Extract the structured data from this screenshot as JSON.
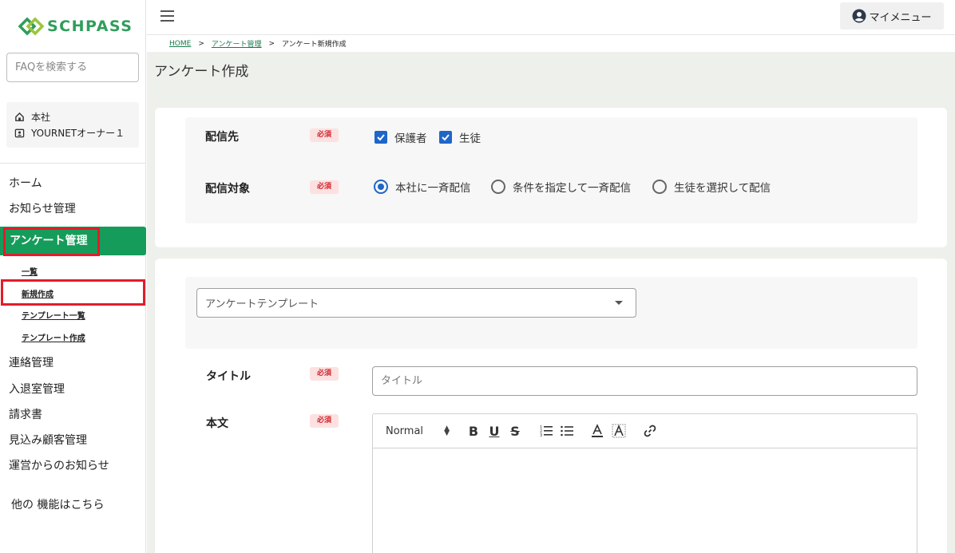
{
  "brand": {
    "name": "SCHPASS",
    "color": "#2f9e5b"
  },
  "sidebar": {
    "faq_placeholder": "FAQを検索する",
    "org": {
      "branch": "本社",
      "user": "YOURNETオーナー１"
    },
    "nav": {
      "home": "ホーム",
      "notice": "お知らせ管理",
      "survey": "アンケート管理",
      "survey_sub": [
        "一覧",
        "新規作成",
        "テンプレート一覧",
        "テンプレート作成"
      ],
      "contact": "連絡管理",
      "attendance": "入退室管理",
      "invoice": "請求書",
      "prospect": "見込み顧客管理",
      "operator_notice": "運営からのお知らせ",
      "other": "他の 機能はこちら"
    },
    "active_color": "#169c5a"
  },
  "topbar": {
    "mymenu": "マイメニュー"
  },
  "breadcrumb": {
    "home": "HOME",
    "survey": "アンケート管理",
    "current": "アンケート新規作成"
  },
  "page": {
    "title": "アンケート作成"
  },
  "form": {
    "required": "必須",
    "destination": {
      "label": "配信先",
      "options": [
        "保護者",
        "生徒"
      ]
    },
    "target": {
      "label": "配信対象",
      "options": [
        "本社に一斉配信",
        "条件を指定して一斉配信",
        "生徒を選択して配信"
      ],
      "selected": 0
    },
    "template": {
      "placeholder": "アンケートテンプレート"
    },
    "title": {
      "label": "タイトル",
      "placeholder": "タイトル"
    },
    "body": {
      "label": "本文",
      "format": "Normal"
    }
  },
  "accent_color": "#1e66c8",
  "highlight_color": "#e11d2a"
}
